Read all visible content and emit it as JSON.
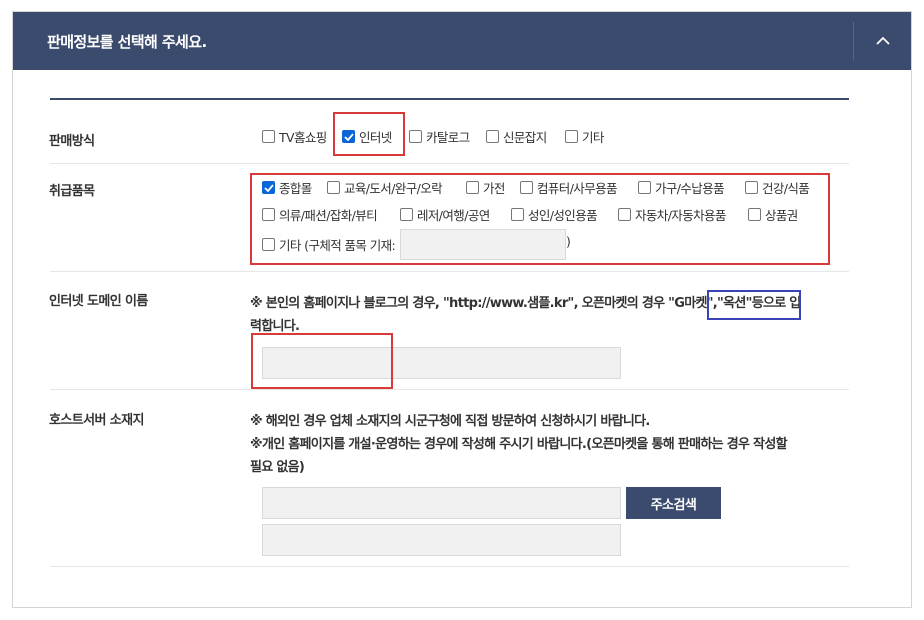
{
  "header": {
    "title": "판매정보를 선택해 주세요.",
    "collapse_icon": "chevron-up-icon"
  },
  "sales_method": {
    "label": "판매방식",
    "options": [
      {
        "label": "TV홈쇼핑",
        "checked": false
      },
      {
        "label": "인터넷",
        "checked": true
      },
      {
        "label": "카탈로그",
        "checked": false
      },
      {
        "label": "신문잡지",
        "checked": false
      },
      {
        "label": "기타",
        "checked": false
      }
    ]
  },
  "categories": {
    "label": "취급품목",
    "options": [
      {
        "label": "종합몰",
        "checked": true
      },
      {
        "label": "교육/도서/완구/오락",
        "checked": false
      },
      {
        "label": "가전",
        "checked": false
      },
      {
        "label": "컴퓨터/사무용품",
        "checked": false
      },
      {
        "label": "가구/수납용품",
        "checked": false
      },
      {
        "label": "건강/식품",
        "checked": false
      },
      {
        "label": "의류/패션/잡화/뷰티",
        "checked": false
      },
      {
        "label": "레저/여행/공연",
        "checked": false
      },
      {
        "label": "성인/성인용품",
        "checked": false
      },
      {
        "label": "자동차/자동차용품",
        "checked": false
      },
      {
        "label": "상품권",
        "checked": false
      },
      {
        "label": "기타 (구체적 품목 기재:",
        "checked": false
      }
    ],
    "other_close": ")",
    "other_value": ""
  },
  "domain": {
    "label": "인터넷 도메인 이름",
    "note_line1": "※ 본인의 홈페이지나 블로그의 경우, \"http://www.샘플.kr\", 오픈마켓의 경우 \"G마켓\",\"옥션\"등으로 입",
    "note_line2": "력합니다.",
    "value": ""
  },
  "host": {
    "label": "호스트서버 소재지",
    "note_line1": "※ 해외인 경우 업체 소재지의 시군구청에 직접 방문하여 신청하시기 바랍니다.",
    "note_line2": "※개인 홈페이지를 개설·운영하는 경우에 작성해 주시기 바랍니다.(오픈마켓을 통해 판매하는 경우 작성할",
    "note_line3": "필요 없음)",
    "search_button": "주소검색",
    "address1": "",
    "address2": ""
  },
  "colors": {
    "header_bg": "#3b4b6e",
    "highlight_red": "#d83a3a",
    "highlight_blue": "#3a44b8",
    "checkbox_checked": "#0a66d6"
  }
}
